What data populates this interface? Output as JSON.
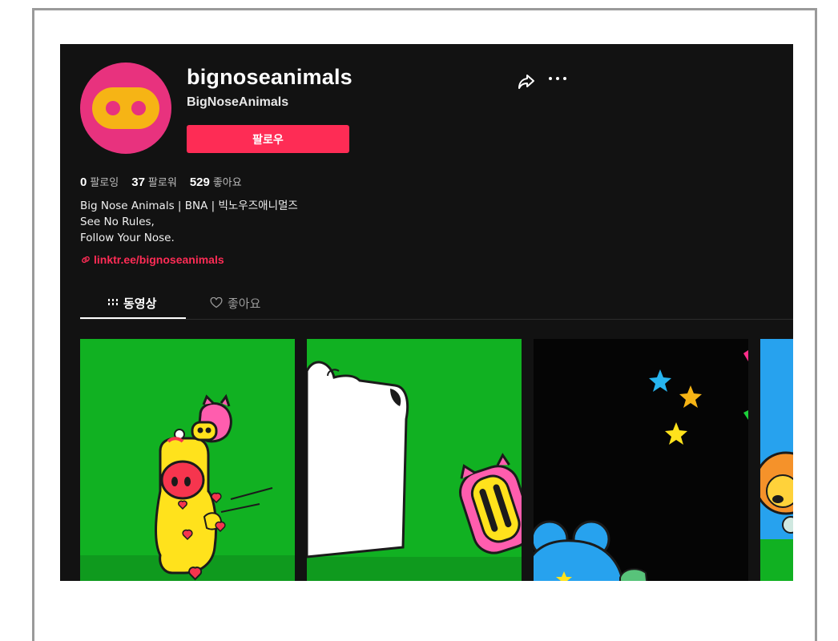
{
  "profile": {
    "username": "bignoseanimals",
    "display_name": "BigNoseAnimals",
    "follow_label": "팔로우"
  },
  "stats": [
    {
      "value": "0",
      "label": "팔로잉"
    },
    {
      "value": "37",
      "label": "팔로워"
    },
    {
      "value": "529",
      "label": "좋아요"
    }
  ],
  "bio": {
    "lines": [
      "Big Nose Animals | BNA | 빅노우즈애니멀즈",
      "See No Rules,",
      "Follow Your Nose."
    ],
    "link": "linktr.ee/bignoseanimals"
  },
  "tabs": {
    "videos": "동영상",
    "likes": "좋아요"
  },
  "icons": {
    "share": "share-icon",
    "more": "more-icon",
    "link": "link-icon",
    "grid": "grid-icon",
    "heart": "heart-outline-icon"
  },
  "colors": {
    "background": "#121212",
    "accent": "#fe2c55",
    "avatar_pink": "#e8327e",
    "avatar_yellow": "#f6b415",
    "thumb_green": "#11b122"
  }
}
